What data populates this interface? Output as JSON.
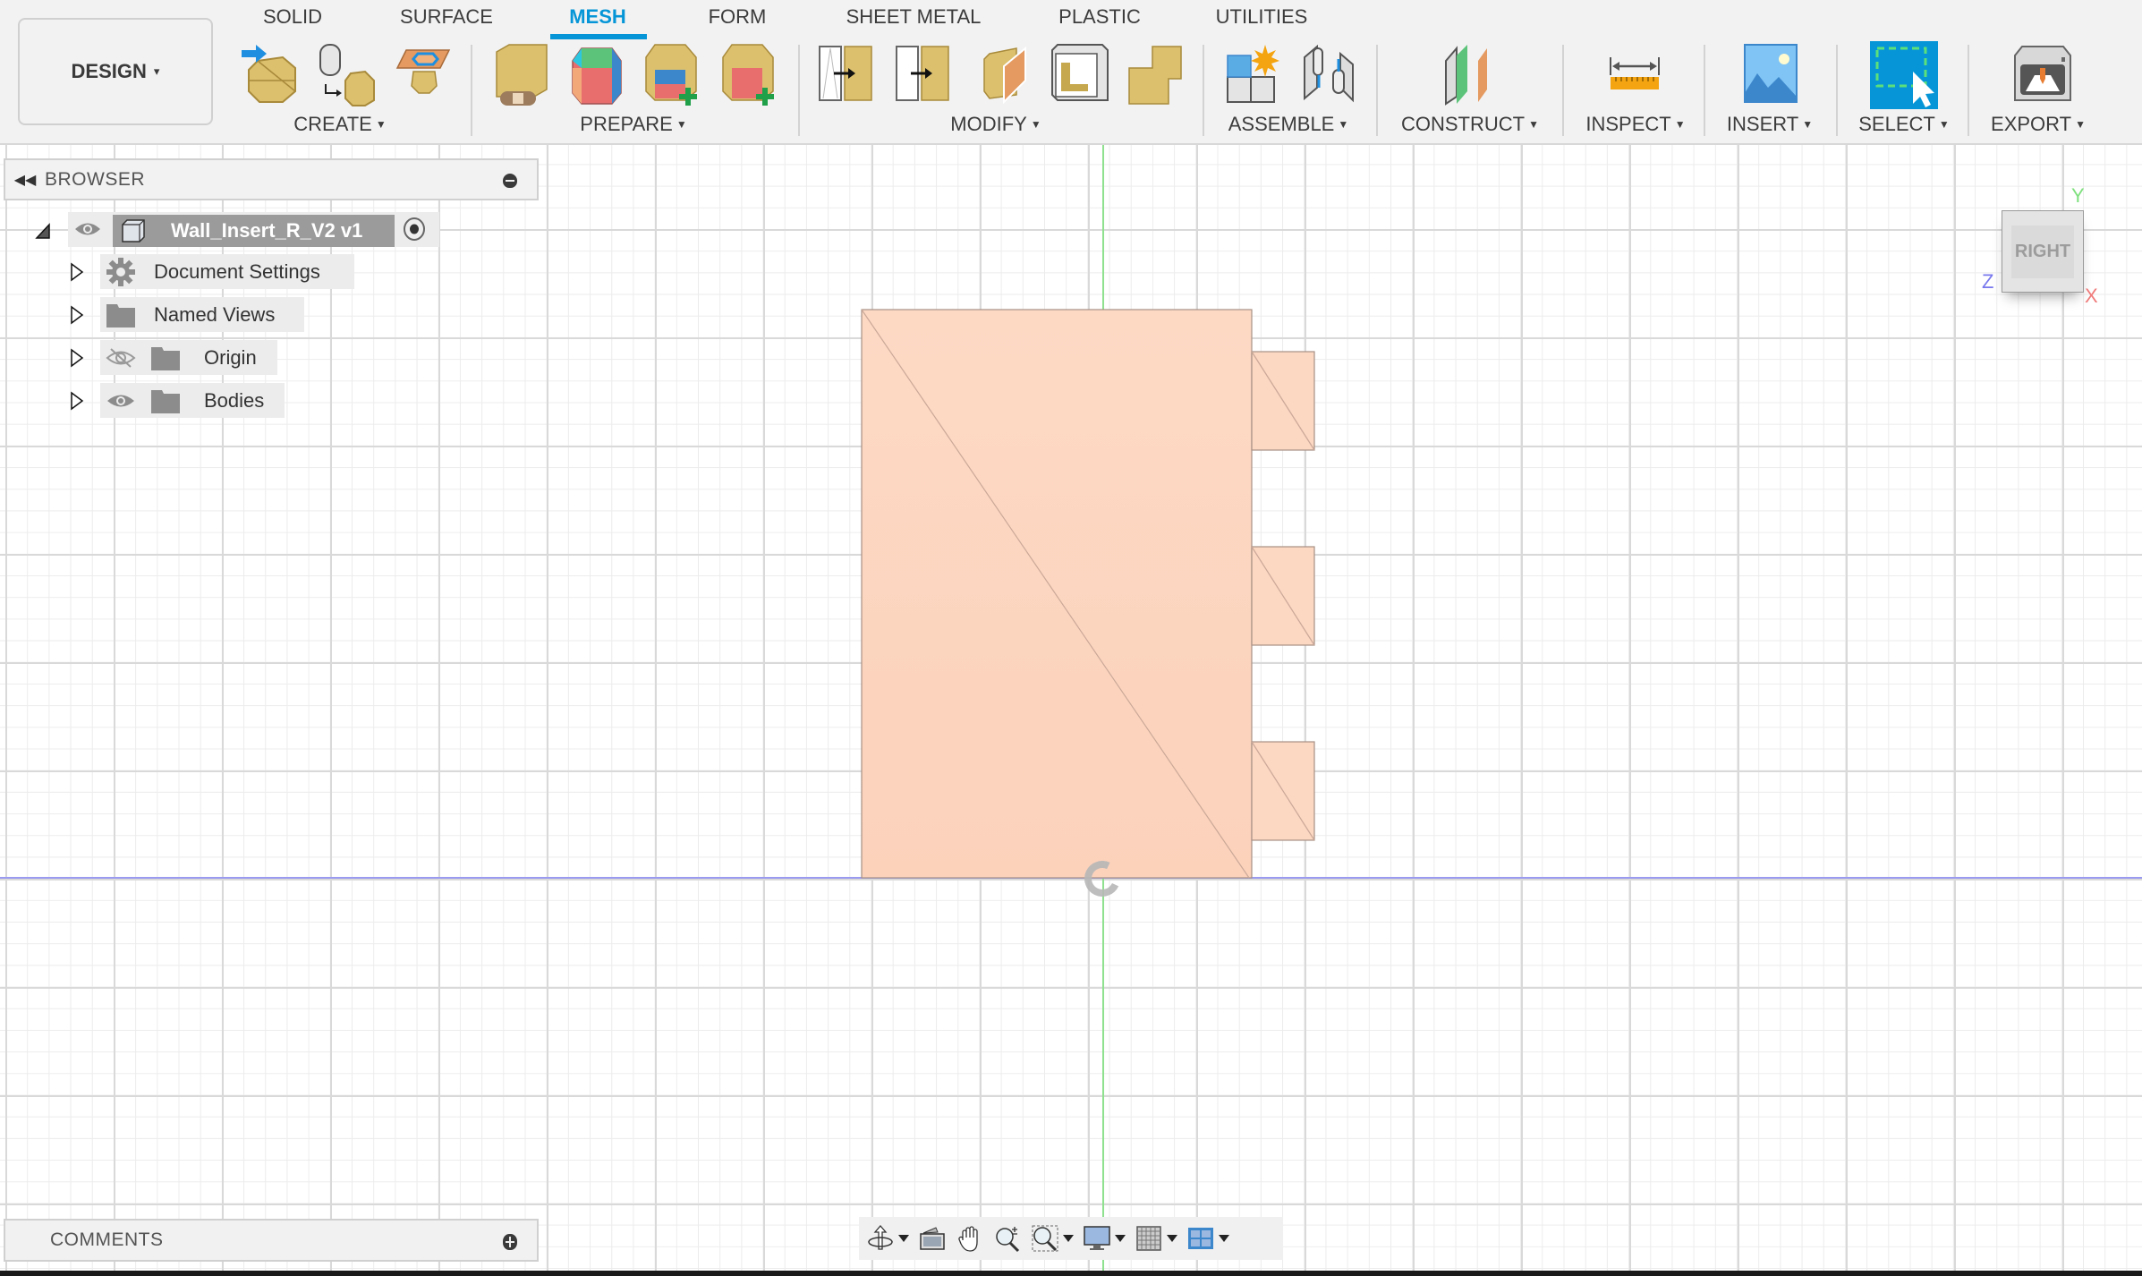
{
  "workspace": {
    "label": "DESIGN",
    "caret": "▾"
  },
  "tabs": [
    {
      "label": "SOLID",
      "active": false
    },
    {
      "label": "SURFACE",
      "active": false
    },
    {
      "label": "MESH",
      "active": true
    },
    {
      "label": "FORM",
      "active": false
    },
    {
      "label": "SHEET METAL",
      "active": false
    },
    {
      "label": "PLASTIC",
      "active": false
    },
    {
      "label": "UTILITIES",
      "active": false
    }
  ],
  "groups": [
    {
      "label": "CREATE",
      "icons": [
        "insert-mesh-icon",
        "tessellate-icon",
        "create-face-group-icon"
      ]
    },
    {
      "label": "PREPARE",
      "icons": [
        "repair-icon",
        "generate-face-groups-icon",
        "combine-face-groups-icon",
        "convert-face-groups-icon"
      ]
    },
    {
      "label": "MODIFY",
      "icons": [
        "remesh-icon",
        "reduce-icon",
        "plane-cut-icon",
        "shell-icon",
        "combine-icon"
      ]
    },
    {
      "label": "ASSEMBLE",
      "icons": [
        "new-component-icon",
        "joint-icon"
      ]
    },
    {
      "label": "CONSTRUCT",
      "icons": [
        "offset-plane-icon"
      ]
    },
    {
      "label": "INSPECT",
      "icons": [
        "measure-icon"
      ]
    },
    {
      "label": "INSERT",
      "icons": [
        "insert-image-icon"
      ]
    },
    {
      "label": "SELECT",
      "icons": [
        "window-select-icon"
      ]
    },
    {
      "label": "EXPORT",
      "icons": [
        "3d-print-icon"
      ]
    }
  ],
  "colors": {
    "accent": "#0696d7",
    "body_fill": "#fcd7c2",
    "body_edge": "#b8a095",
    "axis_y": "#7fe07f",
    "axis_z": "#7777ee",
    "axis_x": "#f07a7a"
  },
  "browser": {
    "title": "BROWSER",
    "root": {
      "label": "Wall_Insert_R_V2 v1",
      "visible": true,
      "active": true
    },
    "items": [
      {
        "label": "Document Settings",
        "icon": "gear-icon",
        "visibility": null
      },
      {
        "label": "Named Views",
        "icon": "folder-icon",
        "visibility": null
      },
      {
        "label": "Origin",
        "icon": "folder-icon",
        "visibility": "hidden"
      },
      {
        "label": "Bodies",
        "icon": "folder-icon",
        "visibility": "visible"
      }
    ]
  },
  "comments": {
    "title": "COMMENTS"
  },
  "viewcube": {
    "face": "RIGHT",
    "axes": {
      "y": "Y",
      "z": "Z",
      "x": "X"
    }
  },
  "navbar": [
    "orbit",
    "look-at",
    "pan",
    "zoom",
    "fit",
    "display-settings",
    "grid-snaps",
    "viewports"
  ]
}
